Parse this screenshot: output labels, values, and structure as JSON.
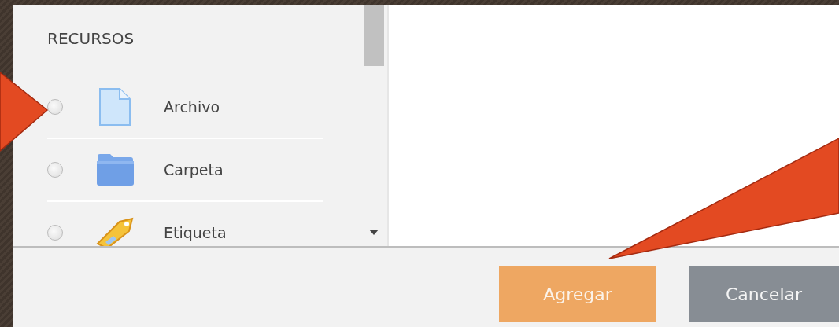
{
  "section_title": "RECURSOS",
  "items": [
    {
      "label": "Archivo",
      "kind": "file",
      "selected": false
    },
    {
      "label": "Carpeta",
      "kind": "folder",
      "selected": false
    },
    {
      "label": "Etiqueta",
      "kind": "tag",
      "selected": false
    }
  ],
  "buttons": [
    {
      "label": "Agregar",
      "kind": "primary"
    },
    {
      "label": "Cancelar",
      "kind": "secondary"
    }
  ]
}
